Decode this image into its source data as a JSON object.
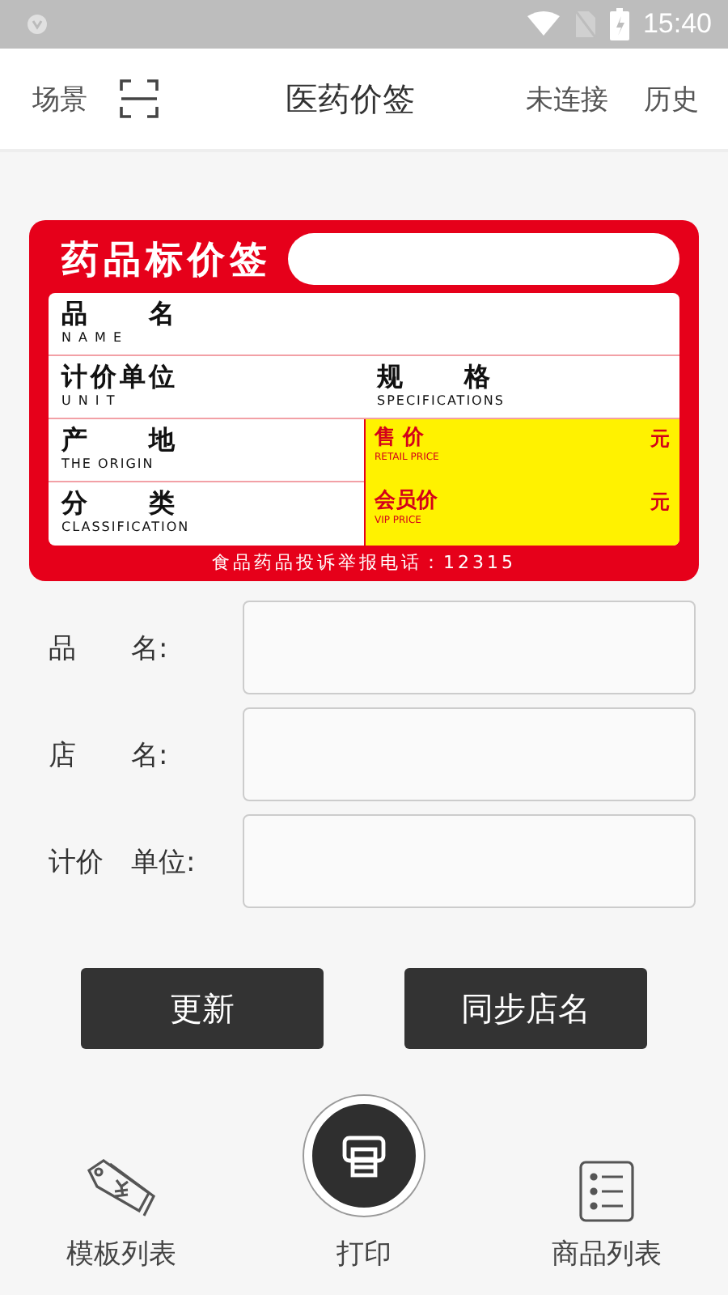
{
  "status_bar": {
    "time": "15:40"
  },
  "header": {
    "scene": "场景",
    "title": "医药价签",
    "connection": "未连接",
    "history": "历史"
  },
  "label": {
    "title": "药品标价签",
    "rows": [
      {
        "cells": [
          {
            "cn": "品 名",
            "en": "N A M E"
          }
        ]
      },
      {
        "cells": [
          {
            "cn": "计价单位",
            "en": "U N I T"
          },
          {
            "cn": "规 格",
            "en": "SPECIFICATIONS"
          }
        ]
      }
    ],
    "left": [
      {
        "cn": "产 地",
        "en": "THE ORIGIN"
      },
      {
        "cn": "分 类",
        "en": "CLASSIFICATION"
      }
    ],
    "prices": [
      {
        "cn": "售 价",
        "en": "RETAIL PRICE",
        "unit": "元"
      },
      {
        "cn": "会员价",
        "en": "VIP PRICE",
        "unit": "元"
      }
    ],
    "footer": "食品药品投诉举报电话：12315"
  },
  "form": {
    "fields": [
      {
        "label": "品　　名:"
      },
      {
        "label": "店　　名:"
      },
      {
        "label": "计价　单位:"
      }
    ]
  },
  "buttons": [
    "更新",
    "同步店名"
  ],
  "nav": [
    {
      "kind": "tag",
      "label": "模板列表"
    },
    {
      "kind": "print",
      "label": "打印"
    },
    {
      "kind": "list",
      "label": "商品列表"
    }
  ]
}
